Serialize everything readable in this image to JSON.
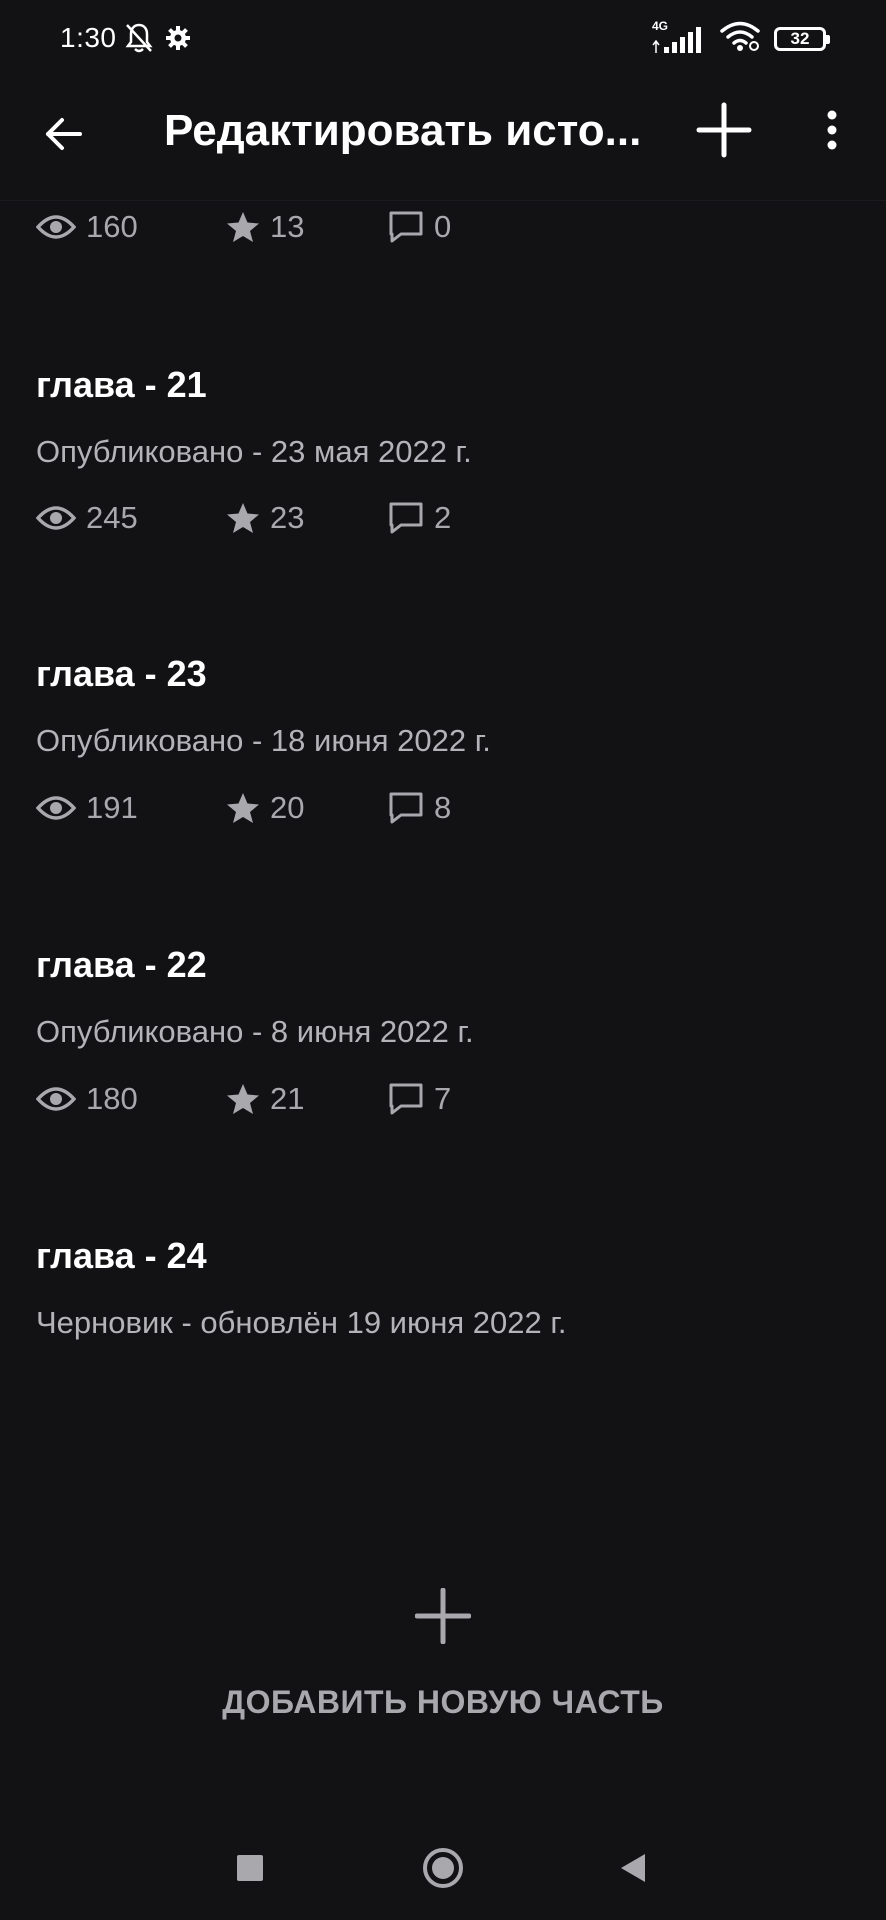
{
  "status_bar": {
    "time": "1:30",
    "network": "4G",
    "battery": "32",
    "icons": [
      "bell-off-icon",
      "gear-icon",
      "signal-icon",
      "wifi-icon",
      "battery-icon"
    ]
  },
  "app_bar": {
    "title": "Редактировать исто...",
    "back_icon": "arrow-left-icon",
    "add_icon": "plus-icon",
    "menu_icon": "more-vert-icon"
  },
  "parts": [
    {
      "title": "",
      "status": "",
      "views": "160",
      "votes": "13",
      "comments": "0"
    },
    {
      "title": "глава - 21",
      "status": "Опубликовано - 23 мая 2022 г.",
      "views": "245",
      "votes": "23",
      "comments": "2"
    },
    {
      "title": "глава - 23",
      "status": "Опубликовано - 18 июня 2022 г.",
      "views": "191",
      "votes": "20",
      "comments": "8"
    },
    {
      "title": "глава - 22",
      "status": "Опубликовано - 8 июня 2022 г.",
      "views": "180",
      "votes": "21",
      "comments": "7"
    },
    {
      "title": "глава - 24",
      "status": "Черновик - обновлён 19 июня 2022 г."
    }
  ],
  "add_part": {
    "label": "ДОБАВИТЬ НОВУЮ ЧАСТЬ",
    "icon": "plus-icon"
  },
  "nav_bar": {
    "icons": [
      "recents-square-icon",
      "home-circle-icon",
      "back-triangle-icon"
    ]
  },
  "colors": {
    "background": "#121114",
    "primary_text": "#ffffff",
    "secondary_text": "#b4b3b8",
    "stat_text": "#a9a8ad"
  }
}
